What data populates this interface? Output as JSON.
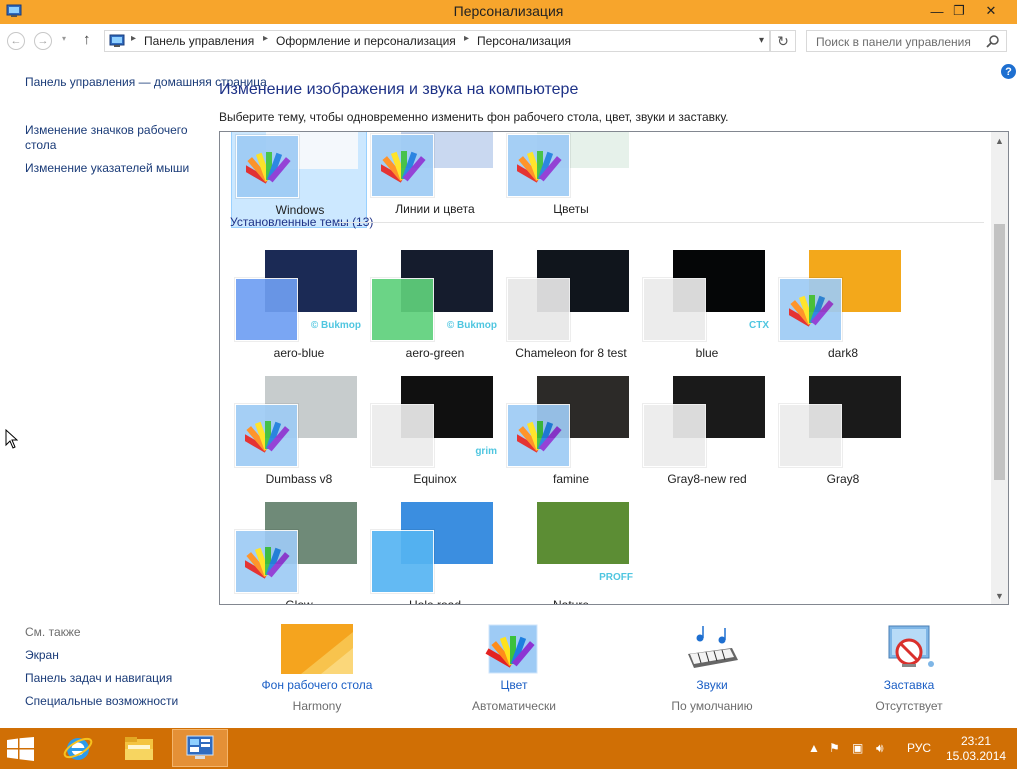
{
  "window": {
    "title": "Персонализация",
    "minimize_glyph": "—",
    "maximize_glyph": "❐",
    "close_glyph": "✕"
  },
  "nav": {
    "back_glyph": "←",
    "forward_glyph": "→",
    "dropdown_glyph": "▾",
    "up_glyph": "↑",
    "refresh_glyph": "↻",
    "breadcrumbs": [
      "Панель управления",
      "Оформление и персонализация",
      "Персонализация"
    ],
    "search_placeholder": "Поиск в панели управления"
  },
  "help_glyph": "?",
  "sidebar": {
    "home_link": "Панель управления — домашняя страница",
    "links": [
      "Изменение значков рабочего стола",
      "Изменение указателей мыши"
    ],
    "see_also_label": "См. также",
    "see_also": [
      "Экран",
      "Панель задач и навигация",
      "Специальные возможности"
    ]
  },
  "main": {
    "heading": "Изменение изображения и звука на компьютере",
    "subheading": "Выберите тему, чтобы одновременно изменить фон рабочего стола, цвет, звуки и заставку.",
    "default_themes": [
      {
        "name": "Windows",
        "selected": true,
        "bg": "#f4f8fc",
        "swatch": "#9ecbf5"
      },
      {
        "name": "Линии и цвета",
        "selected": false,
        "bg": "#c9d8f0",
        "swatch": "#9ecbf5"
      },
      {
        "name": "Цветы",
        "selected": false,
        "bg": "#e6f1ea",
        "swatch": "#9ecbf5"
      }
    ],
    "installed_group": "Установленные темы (13)",
    "installed_themes": [
      {
        "name": "aero-blue",
        "bg": "#1b2a55",
        "swatch": "#6f9ff2",
        "fan": false,
        "mark": "© Bukmop"
      },
      {
        "name": "aero-green",
        "bg": "#151c2d",
        "swatch": "#5fd17c",
        "fan": false,
        "mark": "© Bukmop"
      },
      {
        "name": "Chameleon for 8 test",
        "bg": "#10151c",
        "swatch": "#e8e8e8",
        "fan": false,
        "mark": ""
      },
      {
        "name": "blue",
        "bg": "#050607",
        "swatch": "#ebebeb",
        "fan": false,
        "mark": "CTX"
      },
      {
        "name": "dark8",
        "bg": "#f3a81b",
        "swatch": "#9ecbf5",
        "fan": true,
        "mark": ""
      },
      {
        "name": "Dumbass v8",
        "bg": "#c7cccd",
        "swatch": "#9ecbf5",
        "fan": true,
        "mark": ""
      },
      {
        "name": "Equinox",
        "bg": "#101010",
        "swatch": "#ececec",
        "fan": false,
        "mark": "grim"
      },
      {
        "name": "famine",
        "bg": "#2c2a28",
        "swatch": "#9ecbf5",
        "fan": true,
        "mark": ""
      },
      {
        "name": "Gray8-new red",
        "bg": "#1a1a1a",
        "swatch": "#ececec",
        "fan": false,
        "mark": ""
      },
      {
        "name": "Gray8",
        "bg": "#1a1a1a",
        "swatch": "#ececec",
        "fan": false,
        "mark": ""
      },
      {
        "name": "Glow",
        "bg": "#6f8a78",
        "swatch": "#9ecbf5",
        "fan": true,
        "mark": ""
      },
      {
        "name": "Hole road",
        "bg": "#3b8ee0",
        "swatch": "#56b5f2",
        "fan": false,
        "mark": ""
      },
      {
        "name": "Nature",
        "bg": "#5c8d34",
        "swatch": "",
        "fan": false,
        "mark": "PROFF"
      }
    ]
  },
  "bottom": [
    {
      "name": "Фон рабочего стола",
      "value": "Harmony"
    },
    {
      "name": "Цвет",
      "value": "Автоматически"
    },
    {
      "name": "Звуки",
      "value": "По умолчанию"
    },
    {
      "name": "Заставка",
      "value": "Отсутствует"
    }
  ],
  "taskbar": {
    "language": "РУС",
    "time": "23:21",
    "date": "15.03.2014",
    "accent": "#d06f05"
  },
  "colors": {
    "title_bar": "#f7a52c",
    "link": "#1a5ec5",
    "heading": "#1e3287"
  }
}
